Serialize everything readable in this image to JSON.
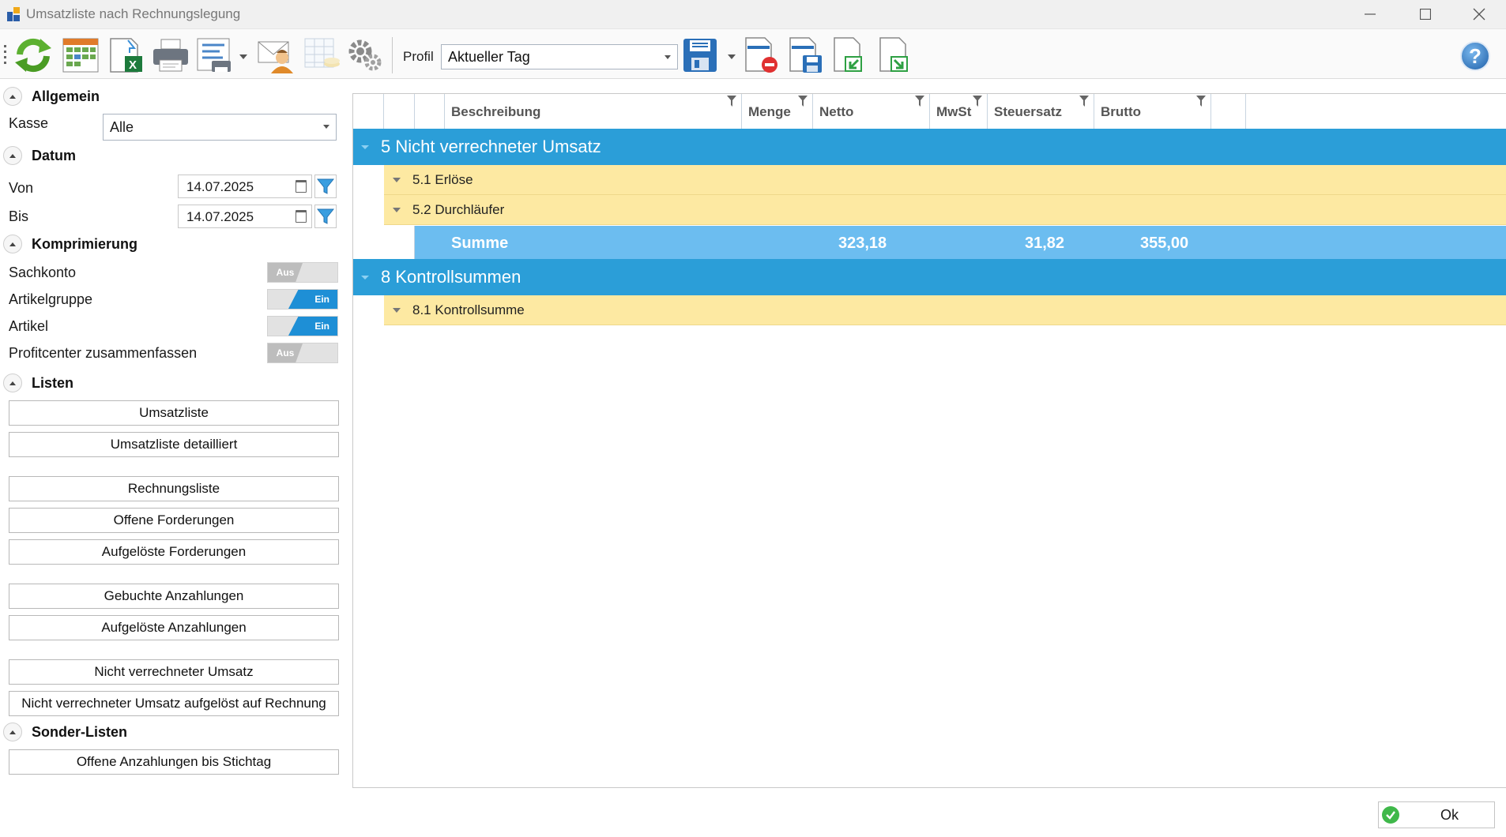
{
  "window": {
    "title": "Umsatzliste nach Rechnungslegung",
    "minimize_icon": "minimize-icon",
    "maximize_icon": "maximize-icon",
    "close_icon": "close-icon"
  },
  "toolbar": {
    "profil_label": "Profil",
    "profil_value": "Aktueller Tag",
    "icons": [
      "refresh-icon",
      "calendar-grid-icon",
      "excel-export-icon",
      "print-icon",
      "print-layout-icon",
      "email-user-icon",
      "table-coins-icon",
      "settings-gears-icon",
      "save-profile-icon",
      "delete-profile-icon",
      "save-as-profile-icon",
      "import-profile-icon",
      "export-profile-icon",
      "help-icon"
    ],
    "help_label": "?"
  },
  "sidebar": {
    "allgemein": {
      "title": "Allgemein",
      "kasse_label": "Kasse",
      "kasse_value": "Alle"
    },
    "datum": {
      "title": "Datum",
      "von_label": "Von",
      "von_value": "14.07.2025",
      "bis_label": "Bis",
      "bis_value": "14.07.2025"
    },
    "komprimierung": {
      "title": "Komprimierung",
      "toggles": [
        {
          "label": "Sachkonto",
          "state": "Aus"
        },
        {
          "label": "Artikelgruppe",
          "state": "Ein"
        },
        {
          "label": "Artikel",
          "state": "Ein"
        },
        {
          "label": "Profitcenter zusammenfassen",
          "state": "Aus"
        }
      ]
    },
    "listen": {
      "title": "Listen",
      "buttons": [
        "Umsatzliste",
        "Umsatzliste detailliert",
        "Rechnungsliste",
        "Offene Forderungen",
        "Aufgelöste Forderungen",
        "Gebuchte Anzahlungen",
        "Aufgelöste Anzahlungen",
        "Nicht verrechneter Umsatz",
        "Nicht verrechneter Umsatz aufgelöst auf Rechnung"
      ]
    },
    "sonder": {
      "title": "Sonder-Listen",
      "buttons": [
        "Offene Anzahlungen bis Stichtag"
      ]
    }
  },
  "grid": {
    "columns": [
      "Beschreibung",
      "Menge",
      "Netto",
      "MwSt",
      "Steuersatz",
      "Brutto"
    ],
    "groups": [
      {
        "label": "5 Nicht verrechneter Umsatz",
        "subgroups": [
          "5.1 Erlöse",
          "5.2 Durchläufer"
        ],
        "summary": {
          "label": "Summe",
          "netto": "323,18",
          "mwst": "31,82",
          "brutto": "355,00"
        }
      },
      {
        "label": "8 Kontrollsummen",
        "subgroups": [
          "8.1 Kontrollsumme"
        ]
      }
    ]
  },
  "footer": {
    "ok_label": "Ok"
  },
  "colors": {
    "group_row": "#2b9ed8",
    "subgroup_row": "#fde9a2",
    "summary_row": "#6cbdf0",
    "toggle_on": "#1e8fd6",
    "toggle_off": "#bdbdbd"
  }
}
